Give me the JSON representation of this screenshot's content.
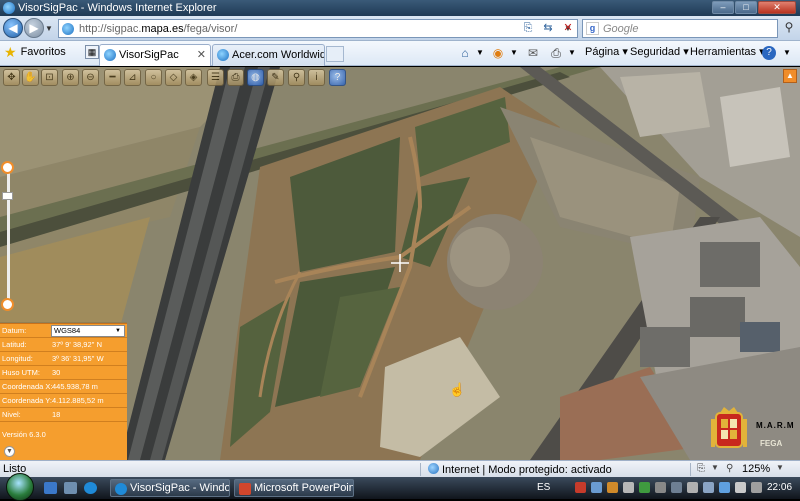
{
  "window": {
    "title": "VisorSigPac - Windows Internet Explorer",
    "controls": {
      "minimize": "–",
      "maximize": "□",
      "close": "✕"
    }
  },
  "address_bar": {
    "url_prefix": "http://sigpac.",
    "url_domain": "mapa.es",
    "url_suffix": "/fega/visor/",
    "search_placeholder": "Google",
    "search_brand": "g"
  },
  "command_bar": {
    "favorites_label": "Favoritos",
    "tabs": [
      {
        "label": "VisorSigPac",
        "active": true
      },
      {
        "label": "Acer.com Worldwid...",
        "active": false
      }
    ],
    "menus": {
      "page": "Página",
      "security": "Seguridad",
      "tools": "Herramientas"
    }
  },
  "map": {
    "toolbar_icons": [
      "nav-icon",
      "pan-icon",
      "zoom-box-icon",
      "zoom-in-icon",
      "zoom-out-icon",
      "measure-line-icon",
      "measure-area-icon",
      "circle-icon",
      "select-icon",
      "identify-icon",
      "layers-icon",
      "print-icon",
      "edit-icon",
      "search-icon",
      "info-icon",
      "help-icon"
    ],
    "zoom_level_fraction": 0.2
  },
  "info_panel": {
    "datum_label": "Datum:",
    "datum_value": "WGS84",
    "lat_label": "Latitud:",
    "lat_value": "37º 9' 38,92'' N",
    "lon_label": "Longitud:",
    "lon_value": "3º 36' 31,95'' W",
    "utm_label": "Huso UTM:",
    "utm_value": "30",
    "x_label": "Coordenada X:",
    "x_value": "445.938,78 m",
    "y_label": "Coordenada Y:",
    "y_value": "4.112.885,52 m",
    "level_label": "Nivel:",
    "level_value": "18",
    "version": "Versión 6.3.0"
  },
  "logos": {
    "ministry": "M.A.R.M",
    "agency": "FEGA"
  },
  "status_bar": {
    "text": "Listo",
    "zone": "Internet | Modo protegido: activado",
    "zoom": "125%"
  },
  "taskbar": {
    "buttons": [
      {
        "label": "VisorSigPac - Windo..."
      },
      {
        "label": "Microsoft PowerPoin..."
      }
    ],
    "language": "ES",
    "time": "22:06"
  },
  "colors": {
    "panel_orange": "#f59e2e",
    "titlebar": "#1f3a55"
  }
}
